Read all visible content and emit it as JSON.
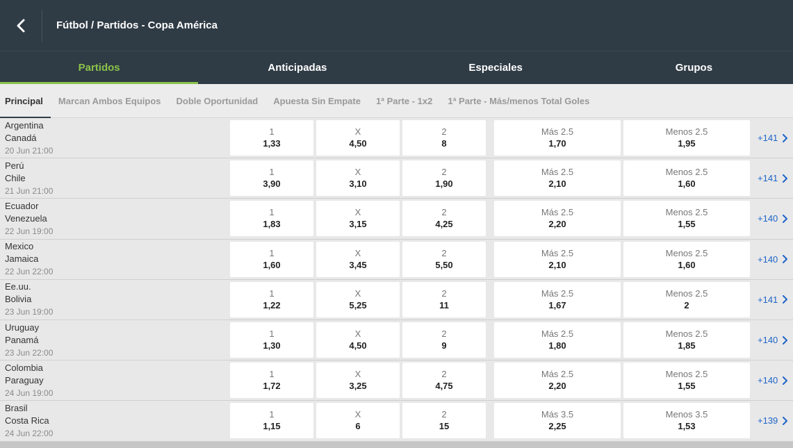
{
  "header": {
    "title": "Fútbol / Partidos - Copa América",
    "back_icon": "chevron-left-icon"
  },
  "tabs": [
    {
      "label": "Partidos",
      "active": true
    },
    {
      "label": "Anticipadas",
      "active": false
    },
    {
      "label": "Especiales",
      "active": false
    },
    {
      "label": "Grupos",
      "active": false
    }
  ],
  "subtabs": [
    {
      "label": "Principal",
      "active": true
    },
    {
      "label": "Marcan Ambos Equipos",
      "active": false
    },
    {
      "label": "Doble Oportunidad",
      "active": false
    },
    {
      "label": "Apuesta Sin Empate",
      "active": false
    },
    {
      "label": "1ª Parte - 1x2",
      "active": false
    },
    {
      "label": "1ª Parte - Más/menos Total Goles",
      "active": false
    }
  ],
  "colors": {
    "header_bg": "#2f3b45",
    "active_tab": "#8bc34a",
    "link": "#1e64c8"
  },
  "matches": [
    {
      "home": "Argentina",
      "away": "Canadá",
      "date": "20 Jun 21:00",
      "odds": [
        {
          "label": "1",
          "value": "1,33"
        },
        {
          "label": "X",
          "value": "4,50"
        },
        {
          "label": "2",
          "value": "8"
        }
      ],
      "totals": [
        {
          "label": "Más 2.5",
          "value": "1,70"
        },
        {
          "label": "Menos 2.5",
          "value": "1,95"
        }
      ],
      "more": "+141"
    },
    {
      "home": "Perú",
      "away": "Chile",
      "date": "21 Jun 21:00",
      "odds": [
        {
          "label": "1",
          "value": "3,90"
        },
        {
          "label": "X",
          "value": "3,10"
        },
        {
          "label": "2",
          "value": "1,90"
        }
      ],
      "totals": [
        {
          "label": "Más 2.5",
          "value": "2,10"
        },
        {
          "label": "Menos 2.5",
          "value": "1,60"
        }
      ],
      "more": "+141"
    },
    {
      "home": "Ecuador",
      "away": "Venezuela",
      "date": "22 Jun 19:00",
      "odds": [
        {
          "label": "1",
          "value": "1,83"
        },
        {
          "label": "X",
          "value": "3,15"
        },
        {
          "label": "2",
          "value": "4,25"
        }
      ],
      "totals": [
        {
          "label": "Más 2.5",
          "value": "2,20"
        },
        {
          "label": "Menos 2.5",
          "value": "1,55"
        }
      ],
      "more": "+140"
    },
    {
      "home": "Mexico",
      "away": "Jamaica",
      "date": "22 Jun 22:00",
      "odds": [
        {
          "label": "1",
          "value": "1,60"
        },
        {
          "label": "X",
          "value": "3,45"
        },
        {
          "label": "2",
          "value": "5,50"
        }
      ],
      "totals": [
        {
          "label": "Más 2.5",
          "value": "2,10"
        },
        {
          "label": "Menos 2.5",
          "value": "1,60"
        }
      ],
      "more": "+140"
    },
    {
      "home": "Ee.uu.",
      "away": "Bolivia",
      "date": "23 Jun 19:00",
      "odds": [
        {
          "label": "1",
          "value": "1,22"
        },
        {
          "label": "X",
          "value": "5,25"
        },
        {
          "label": "2",
          "value": "11"
        }
      ],
      "totals": [
        {
          "label": "Más 2.5",
          "value": "1,67"
        },
        {
          "label": "Menos 2.5",
          "value": "2"
        }
      ],
      "more": "+141"
    },
    {
      "home": "Uruguay",
      "away": "Panamá",
      "date": "23 Jun 22:00",
      "odds": [
        {
          "label": "1",
          "value": "1,30"
        },
        {
          "label": "X",
          "value": "4,50"
        },
        {
          "label": "2",
          "value": "9"
        }
      ],
      "totals": [
        {
          "label": "Más 2.5",
          "value": "1,80"
        },
        {
          "label": "Menos 2.5",
          "value": "1,85"
        }
      ],
      "more": "+140"
    },
    {
      "home": "Colombia",
      "away": "Paraguay",
      "date": "24 Jun 19:00",
      "odds": [
        {
          "label": "1",
          "value": "1,72"
        },
        {
          "label": "X",
          "value": "3,25"
        },
        {
          "label": "2",
          "value": "4,75"
        }
      ],
      "totals": [
        {
          "label": "Más 2.5",
          "value": "2,20"
        },
        {
          "label": "Menos 2.5",
          "value": "1,55"
        }
      ],
      "more": "+140"
    },
    {
      "home": "Brasil",
      "away": "Costa Rica",
      "date": "24 Jun 22:00",
      "odds": [
        {
          "label": "1",
          "value": "1,15"
        },
        {
          "label": "X",
          "value": "6"
        },
        {
          "label": "2",
          "value": "15"
        }
      ],
      "totals": [
        {
          "label": "Más 3.5",
          "value": "2,25"
        },
        {
          "label": "Menos 3.5",
          "value": "1,53"
        }
      ],
      "more": "+139"
    }
  ]
}
